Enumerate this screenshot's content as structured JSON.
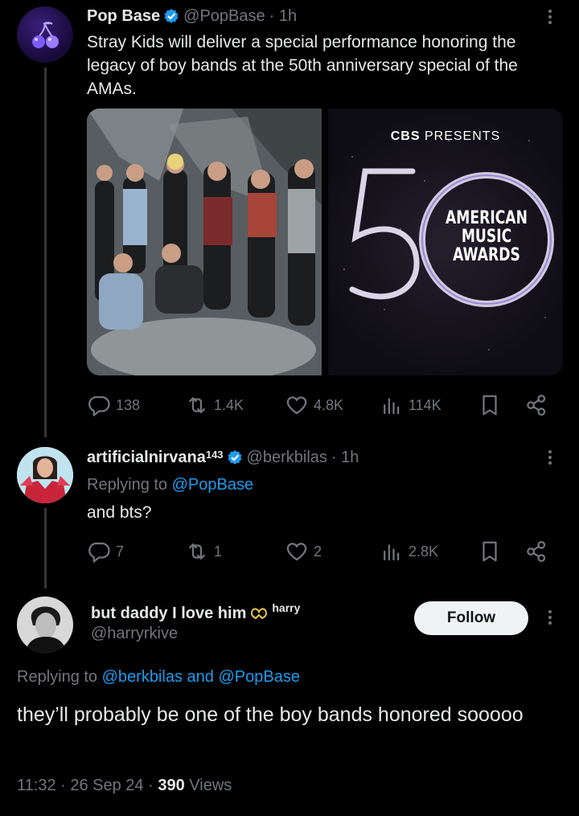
{
  "tweet1": {
    "name": "Pop Base",
    "handle": "@PopBase",
    "time": "· 1h",
    "text": "Stray Kids will deliver a special performance honoring the legacy of boy bands at the 50th anniversary special of the AMAs.",
    "image2": {
      "cbs": "CBS",
      "presents": "PRESENTS",
      "big_number": "50",
      "line1": "AMERICAN",
      "line2": "MUSIC",
      "line3": "AWARDS"
    },
    "stats": {
      "replies": "138",
      "reposts": "1.4K",
      "likes": "4.8K",
      "views": "114K"
    }
  },
  "tweet2": {
    "name": "artificialnirvana",
    "name_sup": "143",
    "handle": "@berkbilas",
    "time": "· 1h",
    "replying_prefix": "Replying to",
    "replying_to": "@PopBase",
    "text": "and bts?",
    "stats": {
      "replies": "7",
      "reposts": "1",
      "likes": "2",
      "views": "2.8K"
    }
  },
  "tweet3": {
    "name": "but daddy I love him",
    "name_suffix": "harry",
    "handle": "@harryrkive",
    "follow_label": "Follow",
    "replying_prefix": "Replying to",
    "replying_to_1": "@berkbilas",
    "replying_and": "and",
    "replying_to_2": "@PopBase",
    "text": "they’ll probably be one of the boy bands honored sooooo",
    "time": "11:32",
    "date": "26 Sep 24",
    "views_count": "390",
    "views_label": "Views"
  },
  "icons": [
    "reply-icon",
    "repost-icon",
    "like-icon",
    "views-icon",
    "bookmark-icon",
    "share-icon",
    "more-icon",
    "verified-badge-icon"
  ],
  "colors": {
    "accent": "#1d9bf0",
    "background": "#000000",
    "text": "#e7e9ea",
    "muted": "#71767b"
  }
}
